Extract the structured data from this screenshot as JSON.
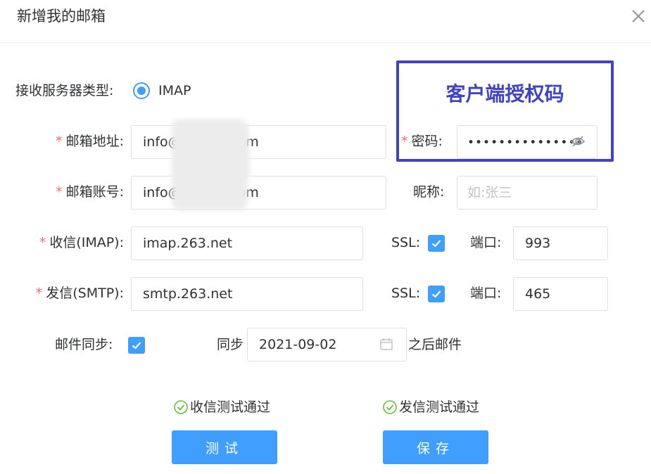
{
  "dialog": {
    "title": "新增我的邮箱"
  },
  "form": {
    "server_type_label": "接收服务器类型:",
    "server_type_option": "IMAP",
    "email_address_label": "邮箱地址:",
    "email_address_prefix": "info@",
    "email_address_suffix": "om",
    "email_account_label": "邮箱账号:",
    "email_account_prefix": "info@",
    "email_account_suffix": "om",
    "password_label": "密码:",
    "password_value": "•••••••••••••••",
    "nickname_label": "昵称:",
    "nickname_placeholder": "如:张三",
    "imap_label": "收信(IMAP):",
    "imap_value": "imap.263.net",
    "imap_ssl_label": "SSL:",
    "imap_port_label": "端口:",
    "imap_port_value": "993",
    "smtp_label": "发信(SMTP):",
    "smtp_value": "smtp.263.net",
    "smtp_ssl_label": "SSL:",
    "smtp_port_label": "端口:",
    "smtp_port_value": "465",
    "sync_label": "邮件同步:",
    "sync_prefix": "同步",
    "sync_date": "2021-09-02",
    "sync_suffix": "之后邮件"
  },
  "annotation": {
    "highlight_text": "客户端授权码"
  },
  "status": {
    "receive_test": "收信测试通过",
    "send_test": "发信测试通过"
  },
  "buttons": {
    "test_label": "测试",
    "save_label": "保存"
  },
  "colors": {
    "primary": "#409eff",
    "required": "#f56c6c",
    "highlight": "#3f43c4",
    "success": "#67c23a"
  }
}
